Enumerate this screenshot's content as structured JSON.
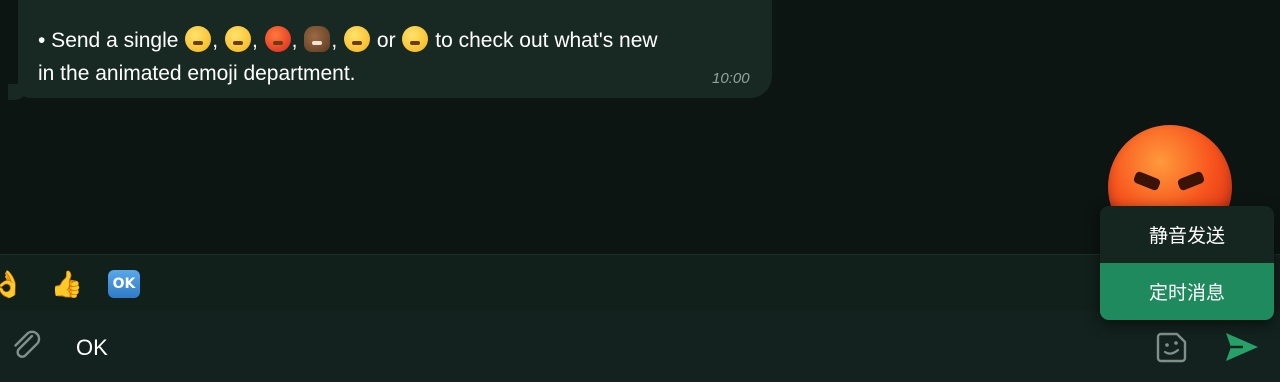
{
  "message": {
    "text_part1": "• Send a single",
    "text_part2": ",",
    "text_part3": ",",
    "text_part4": ",",
    "text_part5": ",",
    "text_part6": "or",
    "text_part7": "to check out what's new",
    "text_line2": "in the animated emoji department.",
    "emojis": [
      "grinning-face",
      "worried-face",
      "angry-face",
      "pile-of-poo",
      "crying-face",
      "surprised-face"
    ],
    "time": "10:00"
  },
  "big_emoji": "angry-face",
  "reactions": [
    {
      "icon": "ok-hand-emoji",
      "glyph": "👌"
    },
    {
      "icon": "thumbs-up-emoji",
      "glyph": "👍"
    },
    {
      "icon": "ok-button-emoji",
      "glyph": "OK"
    }
  ],
  "composer": {
    "input_value": "OK",
    "attach_icon": "paperclip-icon",
    "sticker_icon": "sticker-icon",
    "send_icon": "send-icon"
  },
  "popup": {
    "items": [
      {
        "label": "静音发送",
        "active": false
      },
      {
        "label": "定时消息",
        "active": true
      }
    ]
  },
  "colors": {
    "background": "#0c1512",
    "bubble": "#182924",
    "accent": "#1f8a5e",
    "send": "#26a269"
  }
}
